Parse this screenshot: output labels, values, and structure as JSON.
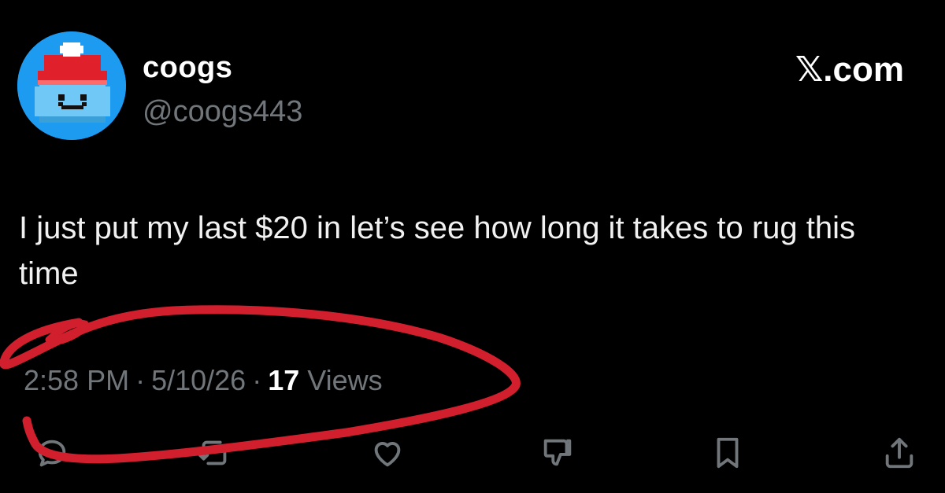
{
  "author": {
    "display_name": "coogs",
    "handle": "@coogs443"
  },
  "brand": {
    "label": "𝕏.com"
  },
  "tweet": {
    "text": "I just put my last $20 in let’s see how long it takes to rug this time"
  },
  "meta": {
    "time": "2:58 PM",
    "separator": "·",
    "date": "5/10/26",
    "views_count": "17",
    "views_label": "Views"
  },
  "actions": {
    "icons": [
      "reply-icon",
      "retweet-icon",
      "like-icon",
      "dislike-icon",
      "bookmark-icon",
      "share-icon"
    ]
  },
  "colors": {
    "background": "#000000",
    "text": "#e7e9ea",
    "muted": "#71767b",
    "annotation_red": "#d21f2e",
    "avatar_bg": "#1d9bf0"
  }
}
